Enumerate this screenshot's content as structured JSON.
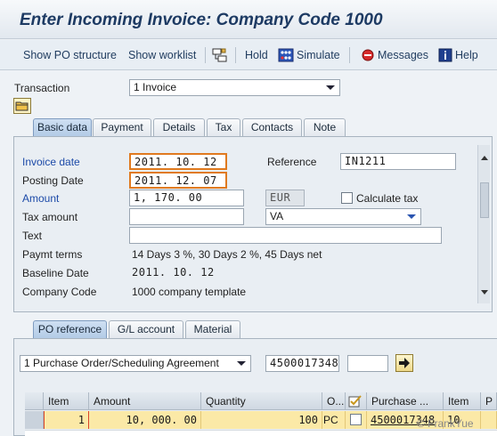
{
  "title": "Enter Incoming Invoice: Company Code 1000",
  "toolbar": {
    "show_po_structure": "Show PO structure",
    "show_worklist": "Show worklist",
    "hold": "Hold",
    "simulate": "Simulate",
    "messages": "Messages",
    "help": "Help"
  },
  "transaction": {
    "label": "Transaction",
    "value": "1 Invoice"
  },
  "tabs": [
    "Basic data",
    "Payment",
    "Details",
    "Tax",
    "Contacts",
    "Note"
  ],
  "basic": {
    "invoice_date_label": "Invoice date",
    "invoice_date": "2011. 10. 12",
    "reference_label": "Reference",
    "reference": "IN1211",
    "posting_date_label": "Posting Date",
    "posting_date": "2011. 12. 07",
    "amount_label": "Amount",
    "amount": "1, 170. 00",
    "currency": "EUR",
    "calculate_tax_label": "Calculate tax",
    "tax_amount_label": "Tax amount",
    "tax_amount": "",
    "tax_code": "VA",
    "text_label": "Text",
    "text": "",
    "paymt_terms_label": "Paymt terms",
    "paymt_terms": "14 Days 3 %, 30 Days 2 %, 45 Days net",
    "baseline_date_label": "Baseline Date",
    "baseline_date": "2011. 10. 12",
    "company_code_label": "Company Code",
    "company_code": "1000 company template"
  },
  "po_tabs": [
    "PO reference",
    "G/L account",
    "Material"
  ],
  "po_ref": {
    "doc_type": "1 Purchase Order/Scheduling Agreement",
    "po_number": "4500017348",
    "extra": ""
  },
  "table": {
    "headers": [
      "Item",
      "Amount",
      "Quantity",
      "O...",
      "",
      "Purchase ...",
      "Item",
      "P"
    ],
    "rows": [
      {
        "item": "1",
        "amount": "10, 000. 00",
        "quantity": "100",
        "order_unit": "PC",
        "purchase_order": "4500017348",
        "po_item": "10"
      }
    ]
  },
  "watermark": "© FrankYue"
}
